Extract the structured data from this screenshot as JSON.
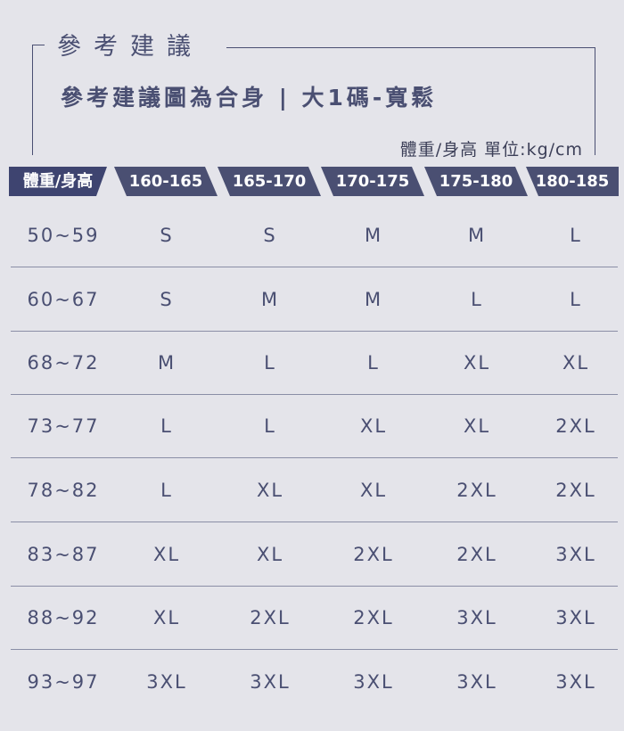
{
  "section_title": "參考建議",
  "headline": "參考建議圖為合身 | 大1碼-寬鬆",
  "unit_note": "體重/身高 單位:kg/cm",
  "table": {
    "corner_label": "體重/身高",
    "height_columns": [
      "160-165",
      "165-170",
      "170-175",
      "175-180",
      "180-185"
    ],
    "rows": [
      {
        "weight": "50~59",
        "sizes": [
          "S",
          "S",
          "M",
          "M",
          "L"
        ]
      },
      {
        "weight": "60~67",
        "sizes": [
          "S",
          "M",
          "M",
          "L",
          "L"
        ]
      },
      {
        "weight": "68~72",
        "sizes": [
          "M",
          "L",
          "L",
          "XL",
          "XL"
        ]
      },
      {
        "weight": "73~77",
        "sizes": [
          "L",
          "L",
          "XL",
          "XL",
          "2XL"
        ]
      },
      {
        "weight": "78~82",
        "sizes": [
          "L",
          "XL",
          "XL",
          "2XL",
          "2XL"
        ]
      },
      {
        "weight": "83~87",
        "sizes": [
          "XL",
          "XL",
          "2XL",
          "2XL",
          "3XL"
        ]
      },
      {
        "weight": "88~92",
        "sizes": [
          "XL",
          "2XL",
          "2XL",
          "3XL",
          "3XL"
        ]
      },
      {
        "weight": "93~97",
        "sizes": [
          "3XL",
          "3XL",
          "3XL",
          "3XL",
          "3XL"
        ]
      }
    ]
  },
  "colors": {
    "background": "#e4e4ea",
    "accent": "#4a4f72",
    "header_text": "#ffffff"
  }
}
